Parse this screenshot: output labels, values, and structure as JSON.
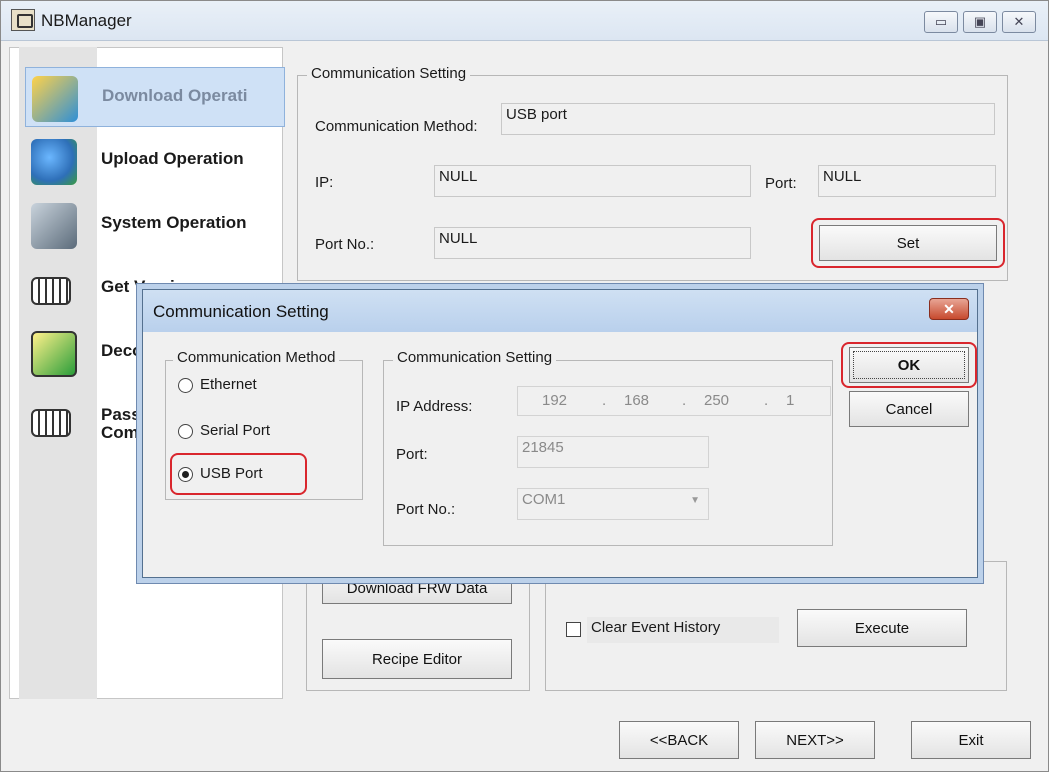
{
  "window": {
    "title": "NBManager",
    "controls": {
      "minimize": "▭",
      "maximize": "▣",
      "close": "✕"
    }
  },
  "sidebar": {
    "items": [
      {
        "label": "Download Operati",
        "icon": "download-icon",
        "color": "#2f8fd6"
      },
      {
        "label": "Upload Operation",
        "icon": "upload-icon",
        "color": "#3b9c3f"
      },
      {
        "label": "System Operation",
        "icon": "system-tools-icon",
        "color": "#7a8a9a"
      },
      {
        "label": "Get Version",
        "icon": "get-version-icon",
        "color": "#333333"
      },
      {
        "label": "Deco",
        "icon": "decompile-icon",
        "color": "#2a9d3a"
      },
      {
        "label": "Pass",
        "label2": "Com",
        "icon": "password-icon",
        "color": "#333333"
      }
    ]
  },
  "comm_setting": {
    "title": "Communication Setting",
    "method_label": "Communication Method:",
    "method_value": "USB port",
    "ip_label": "IP:",
    "ip_value": "NULL",
    "port_label": "Port:",
    "port_value": "NULL",
    "portno_label": "Port No.:",
    "portno_value": "NULL",
    "set_button": "Set"
  },
  "download_panel": {
    "download_frw_button": "Download FRW Data",
    "recipe_editor_button": "Recipe Editor",
    "clear_event_history": "Clear Event History",
    "execute_button": "Execute"
  },
  "footer": {
    "back": "<<BACK",
    "next": "NEXT>>",
    "exit": "Exit"
  },
  "dialog": {
    "title": "Communication Setting",
    "close": "✕",
    "method_group": {
      "title": "Communication Method",
      "options": [
        {
          "label": "Ethernet",
          "selected": false
        },
        {
          "label": "Serial Port",
          "selected": false
        },
        {
          "label": "USB Port",
          "selected": true
        }
      ]
    },
    "setting_group": {
      "title": "Communication Setting",
      "ip_label": "IP Address:",
      "ip_octets": [
        "192",
        "168",
        "250",
        "1"
      ],
      "ip_sep": ".",
      "port_label": "Port:",
      "port_value": "21845",
      "portno_label": "Port No.:",
      "portno_value": "COM1"
    },
    "ok_button": "OK",
    "cancel_button": "Cancel"
  },
  "colors": {
    "highlight": "#d9262d",
    "active_nav": "#cfe1f6",
    "dialog_title": "#b9d0ec"
  }
}
